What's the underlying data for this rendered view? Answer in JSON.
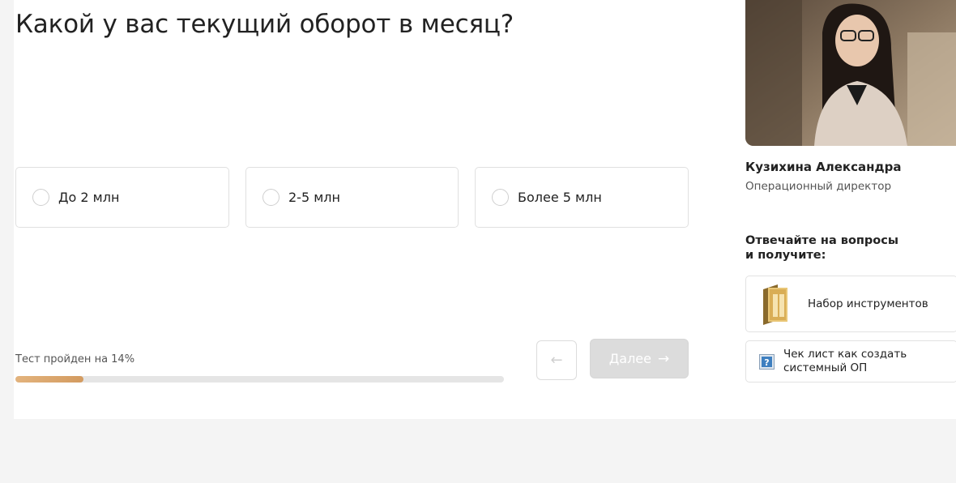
{
  "quiz": {
    "question": "Какой у вас текущий оборот в месяц?",
    "options": [
      {
        "label": "До 2 млн"
      },
      {
        "label": "2-5 млн"
      },
      {
        "label": "Более 5 млн"
      }
    ],
    "progress_text": "Тест пройден на 14%",
    "progress_percent": 14,
    "back_icon": "arrow-left-icon",
    "next_label": "Далее",
    "next_icon": "arrow-right-icon"
  },
  "manager": {
    "name": "Кузихина Александра",
    "role": "Операционный директор"
  },
  "bonuses": {
    "title": "Отвечайте на вопросы и получите:",
    "items": [
      {
        "label": "Набор инструментов",
        "icon": "folder-icon"
      },
      {
        "label": "Чек лист как создать системный ОП",
        "icon": "help-icon"
      }
    ]
  },
  "colors": {
    "accent": "#d39b60",
    "disabled_button": "#dcdcdc",
    "background": "#f4f4f4"
  }
}
